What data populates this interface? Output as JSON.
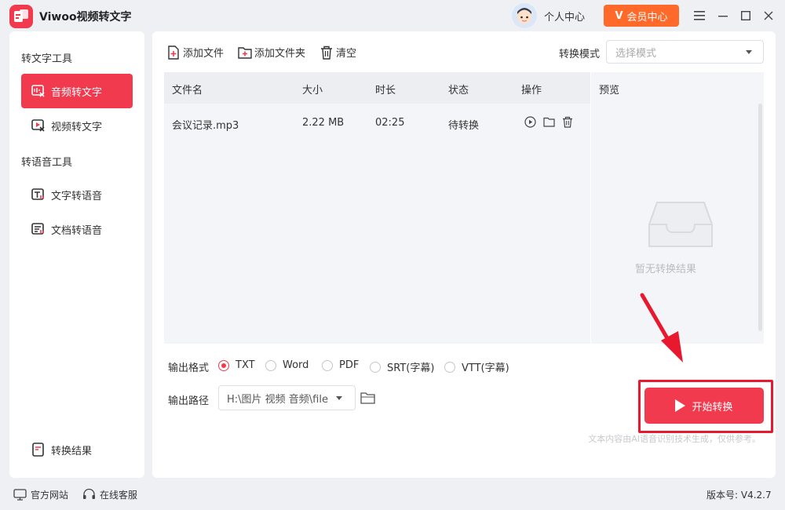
{
  "app": {
    "title": "Viwoo视频转文字"
  },
  "header": {
    "user_center": "个人中心",
    "vip_label": "会员中心",
    "vip_mark": "V"
  },
  "sidebar": {
    "group1": "转文字工具",
    "group2": "转语音工具",
    "items": [
      {
        "label": "音频转文字"
      },
      {
        "label": "视频转文字"
      },
      {
        "label": "文字转语音"
      },
      {
        "label": "文档转语音"
      }
    ],
    "result": "转换结果"
  },
  "toolbar": {
    "add_file": "添加文件",
    "add_folder": "添加文件夹",
    "clear": "清空",
    "mode_label": "转换模式",
    "mode_placeholder": "选择模式"
  },
  "table": {
    "headers": {
      "name": "文件名",
      "size": "大小",
      "duration": "时长",
      "status": "状态",
      "action": "操作"
    },
    "rows": [
      {
        "name": "会议记录.mp3",
        "size": "2.22 MB",
        "duration": "02:25",
        "status": "待转换"
      }
    ]
  },
  "preview": {
    "title": "预览",
    "empty": "暂无转换结果"
  },
  "output": {
    "format_label": "输出格式",
    "formats": [
      {
        "label": "TXT",
        "checked": true
      },
      {
        "label": "Word",
        "checked": false
      },
      {
        "label": "PDF",
        "checked": false
      },
      {
        "label": "SRT(字幕)",
        "checked": false
      },
      {
        "label": "VTT(字幕)",
        "checked": false
      }
    ],
    "path_label": "输出路径",
    "path_value": "H:\\图片 视频 音频\\file"
  },
  "start_button": "开始转换",
  "disclaimer": "文本内容由AI语音识别技术生成，仅供参考。",
  "footer": {
    "website": "官方网站",
    "service": "在线客服",
    "version": "版本号: V4.2.7"
  },
  "colors": {
    "accent": "#f23a4f",
    "vip": "#ff6a2b",
    "highlight": "#e8192e"
  }
}
